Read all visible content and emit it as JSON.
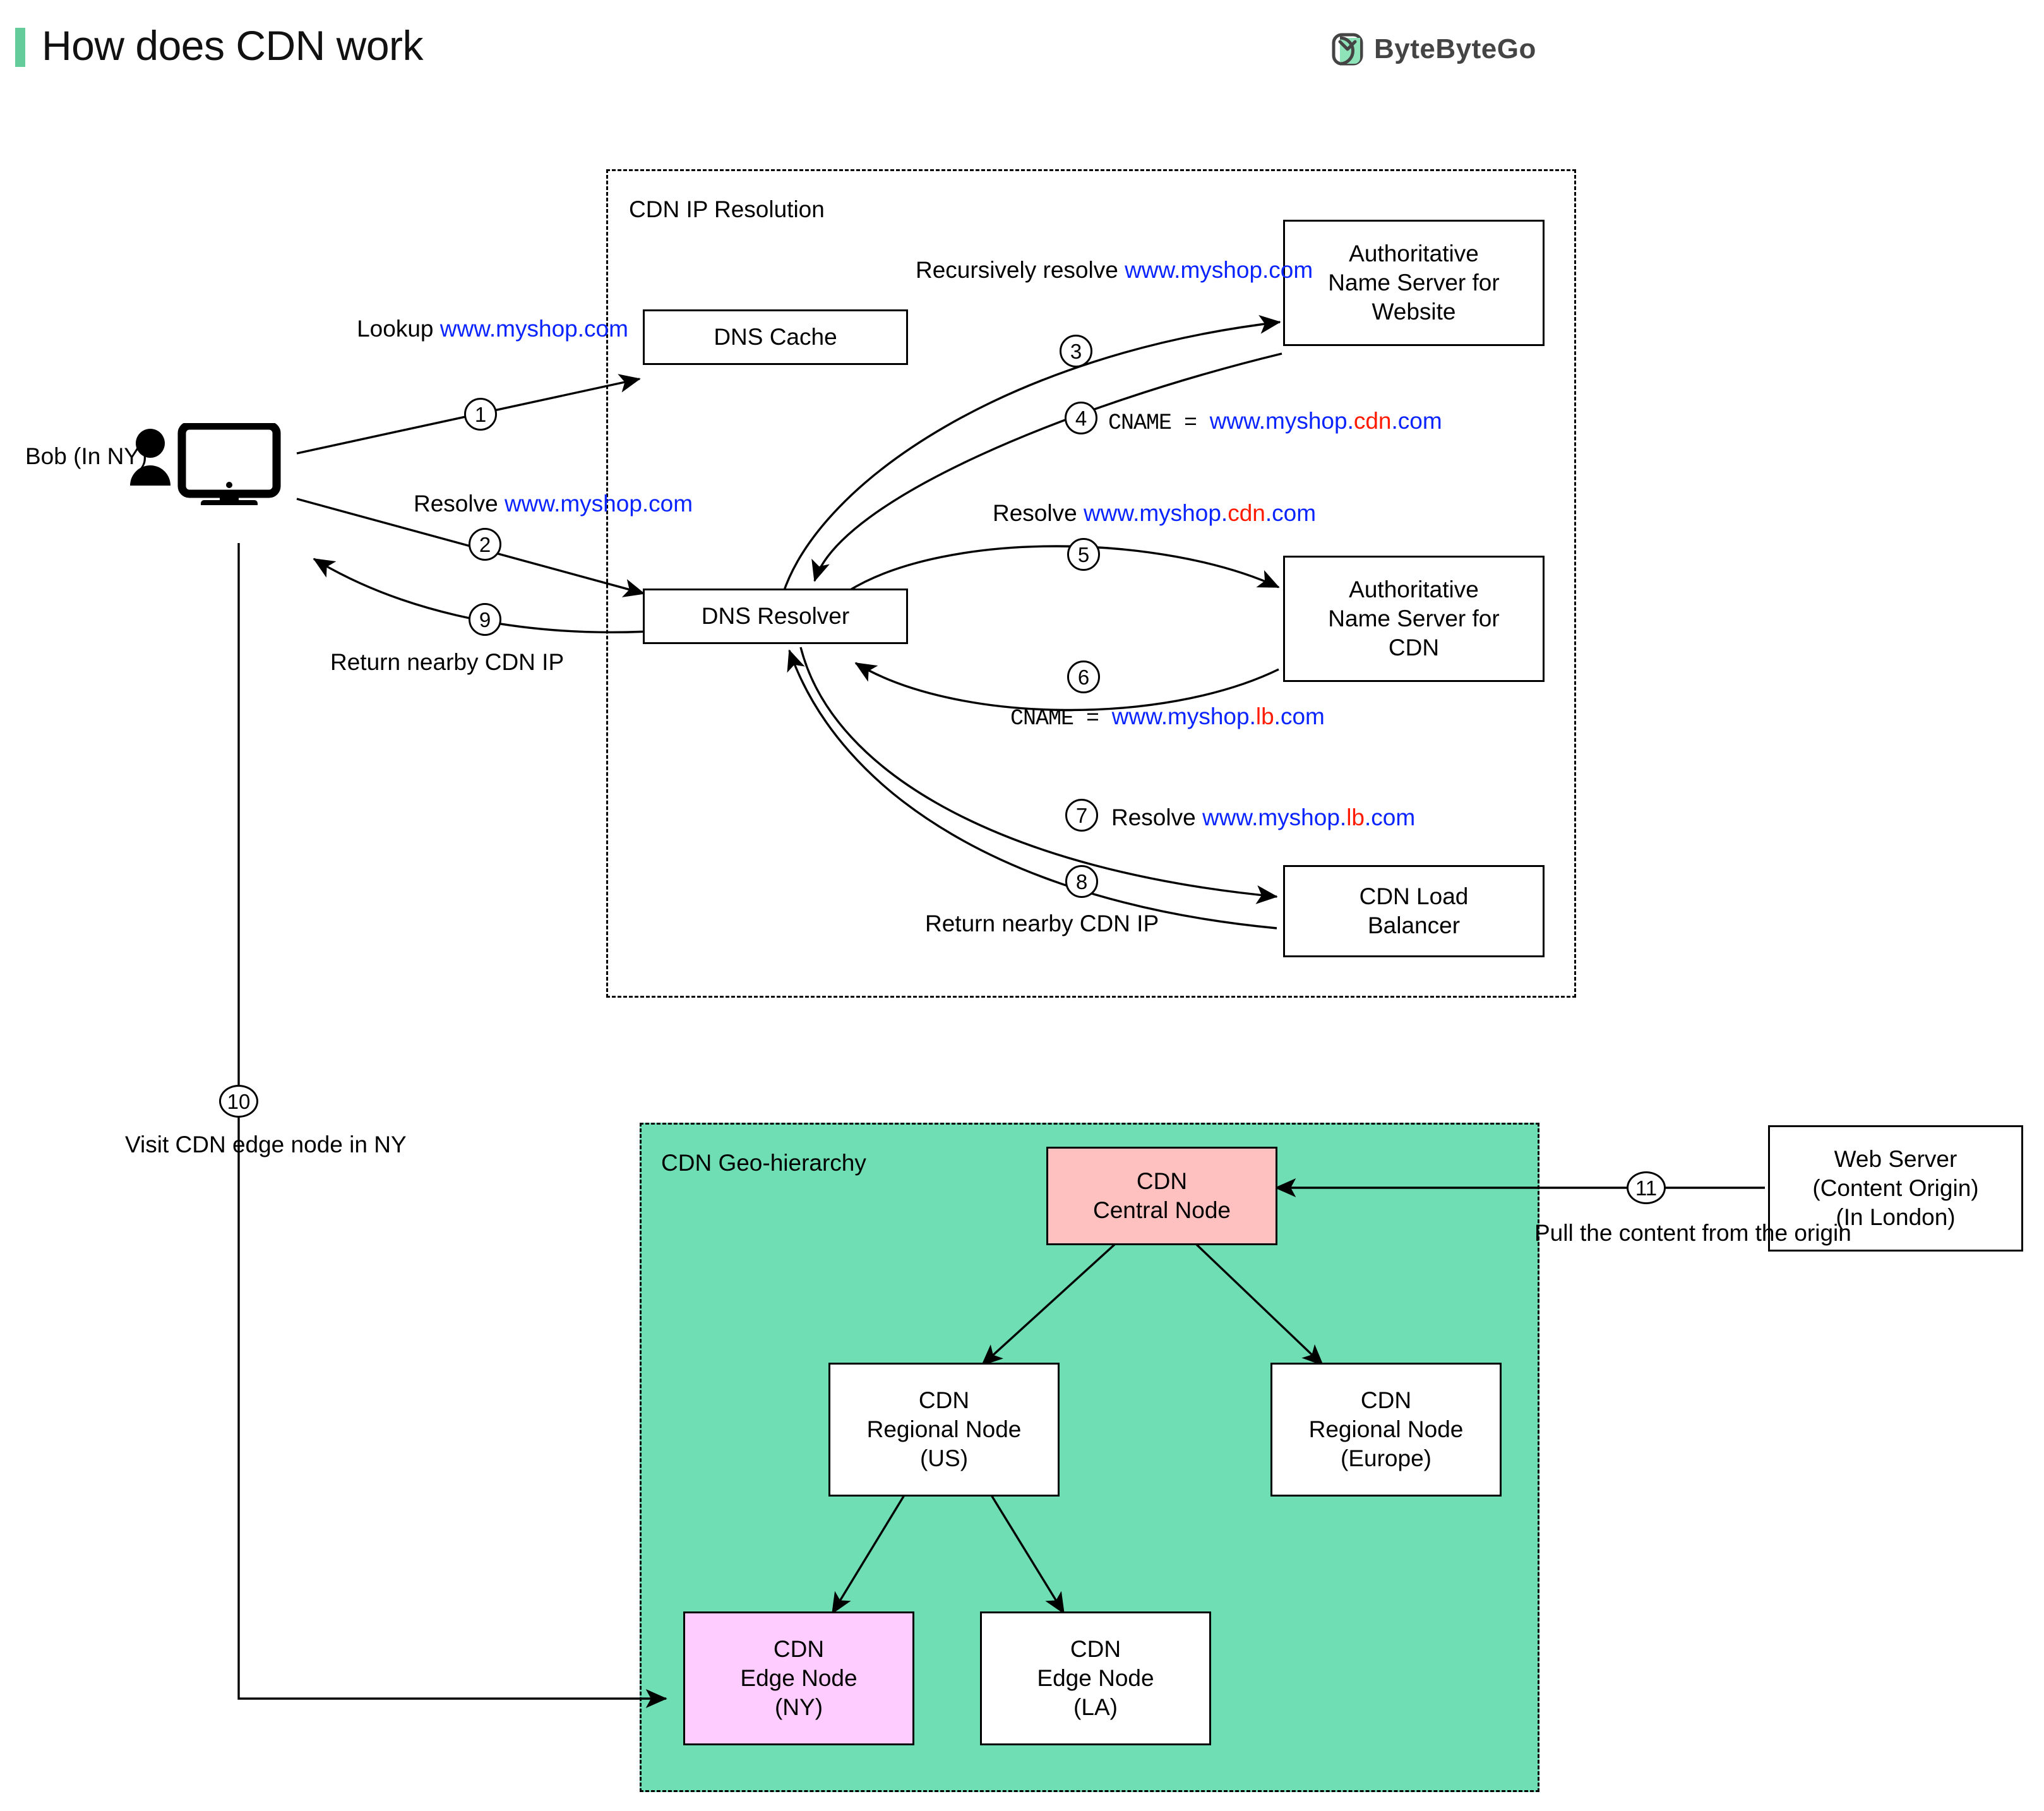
{
  "header": {
    "title": "How does CDN work",
    "logo_text": "ByteByteGo",
    "accent_color": "#63CC9A"
  },
  "actors": {
    "bob_name": "Bob",
    "bob_location": "(In NY)"
  },
  "groups": {
    "ip_resolution": {
      "label": "CDN IP Resolution"
    },
    "geo_hierarchy": {
      "label": "CDN Geo-hierarchy",
      "fill": "#6FDEB4"
    }
  },
  "nodes": {
    "dns_cache": {
      "line1": "DNS Cache"
    },
    "dns_resolver": {
      "line1": "DNS Resolver"
    },
    "ns_website": {
      "line1": "Authoritative",
      "line2": "Name Server for",
      "line3": "Website"
    },
    "ns_cdn": {
      "line1": "Authoritative",
      "line2": "Name Server for",
      "line3": "CDN"
    },
    "cdn_lb": {
      "line1": "CDN Load",
      "line2": "Balancer"
    },
    "cdn_central": {
      "line1": "CDN",
      "line2": "Central Node",
      "fill": "#FFC0C0"
    },
    "cdn_regional_us": {
      "line1": "CDN",
      "line2": "Regional Node",
      "line3": "(US)",
      "fill": "#FFFFFF"
    },
    "cdn_regional_eu": {
      "line1": "CDN",
      "line2": "Regional Node",
      "line3": "(Europe)",
      "fill": "#FFFFFF"
    },
    "cdn_edge_ny": {
      "line1": "CDN",
      "line2": "Edge Node",
      "line3": "(NY)",
      "fill": "#FFCCFF"
    },
    "cdn_edge_la": {
      "line1": "CDN",
      "line2": "Edge Node",
      "line3": "(LA)",
      "fill": "#FFFFFF"
    },
    "web_server": {
      "line1": "Web Server",
      "line2": "(Content Origin)",
      "line3": "(In London)"
    }
  },
  "steps": {
    "s1": {
      "num": "1",
      "label_line1": "Lookup",
      "label_line2": "www.myshop.com"
    },
    "s2": {
      "num": "2",
      "label_prefix": "Resolve ",
      "label_domain": "www.myshop.com"
    },
    "s3": {
      "num": "3",
      "label_line1": "Recursively resolve",
      "label_line2": "www.myshop.com"
    },
    "s4": {
      "num": "4",
      "key": "CNAME",
      "eq": "=",
      "value_base": "www.myshop.",
      "value_mid": "cdn",
      "value_tld": ".com"
    },
    "s5": {
      "num": "5",
      "label_prefix": "Resolve ",
      "value_base": "www.myshop.",
      "value_mid": "cdn",
      "value_tld": ".com"
    },
    "s6": {
      "num": "6",
      "key": "CNAME",
      "eq": "=",
      "value_base": "www.myshop.",
      "value_mid": "lb",
      "value_tld": ".com"
    },
    "s7": {
      "num": "7",
      "label_prefix": "Resolve ",
      "value_base": "www.myshop.",
      "value_mid": "lb",
      "value_tld": ".com"
    },
    "s8": {
      "num": "8",
      "label": "Return nearby CDN IP"
    },
    "s9": {
      "num": "9",
      "label": "Return nearby CDN IP"
    },
    "s10": {
      "num": "10",
      "label_line1": "Visit CDN",
      "label_line2": "edge node",
      "label_line3": "in NY"
    },
    "s11": {
      "num": "11",
      "label_line1": "Pull the",
      "label_line2": "content from",
      "label_line3": "the origin"
    }
  },
  "colors": {
    "blue": "#0A24FF",
    "red": "#FF1A00",
    "green_fill": "#6FDEB4",
    "pink_fill": "#FFC0C0",
    "magenta_fill": "#FFCCFF"
  }
}
